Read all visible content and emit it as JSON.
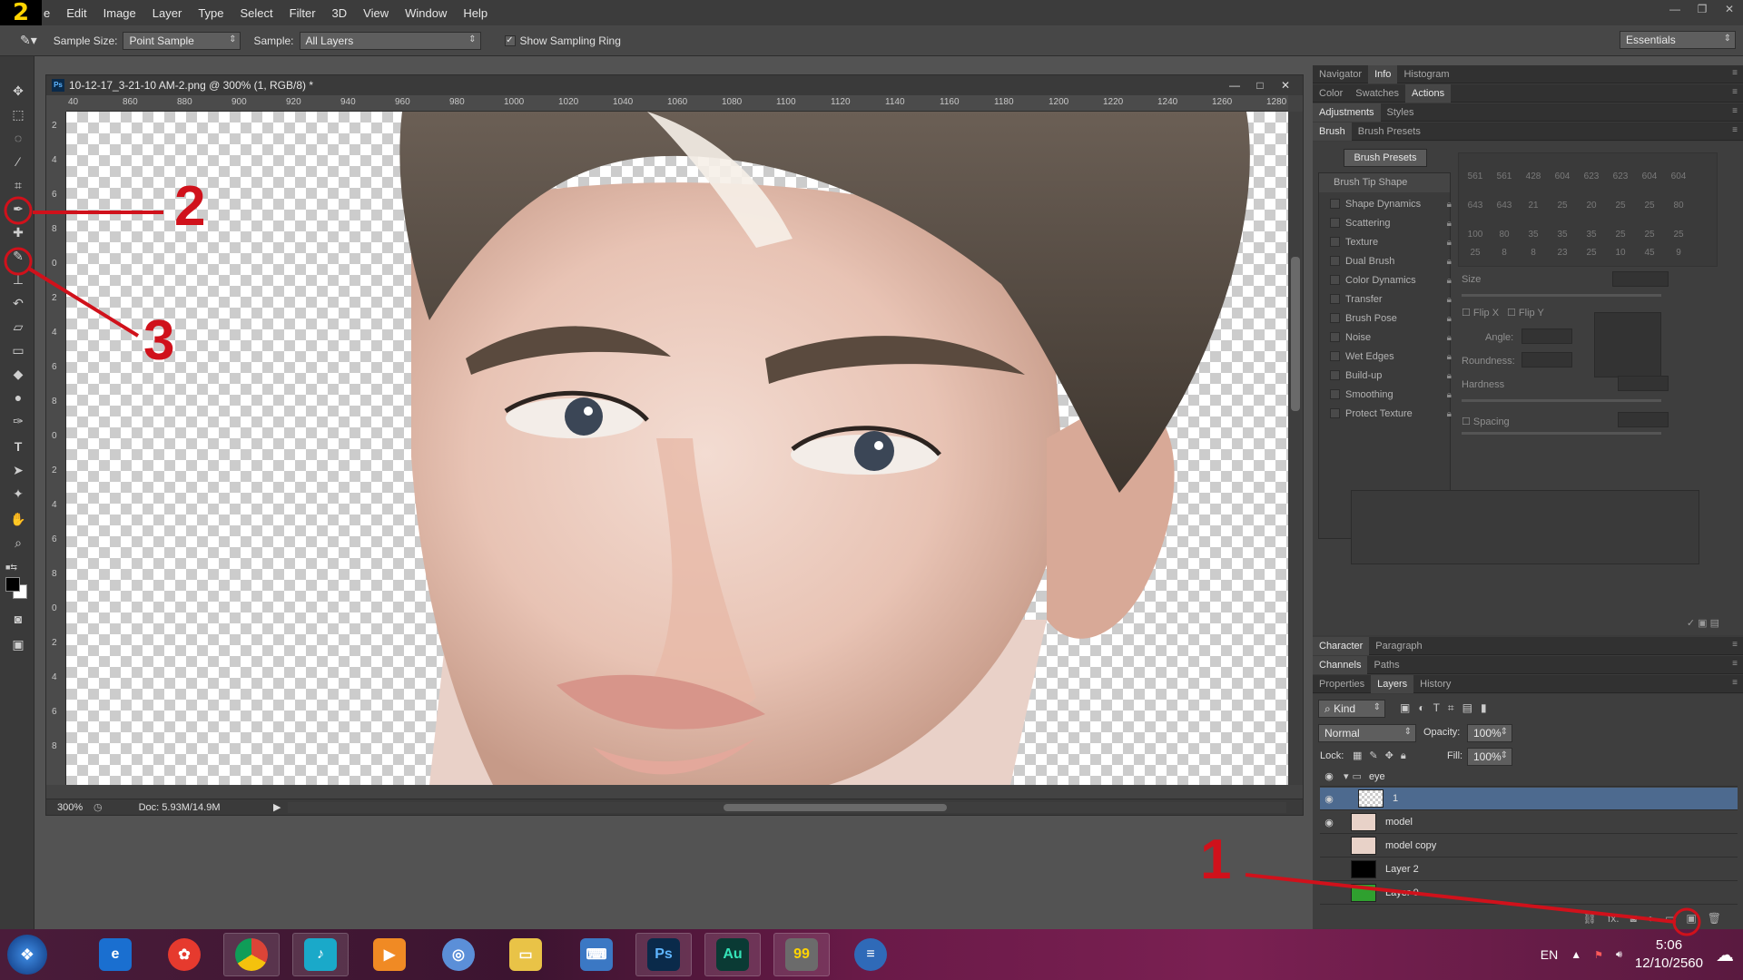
{
  "app": {
    "logo_text": "2",
    "menu": [
      "e",
      "Edit",
      "Image",
      "Layer",
      "Type",
      "Select",
      "Filter",
      "3D",
      "View",
      "Window",
      "Help"
    ],
    "window_controls": [
      "—",
      "❐",
      "✕"
    ]
  },
  "options_bar": {
    "sample_size_label": "Sample Size:",
    "sample_size_value": "Point Sample",
    "sample_label": "Sample:",
    "sample_value": "All Layers",
    "show_ring_label": "Show Sampling Ring",
    "workspace": "Essentials"
  },
  "document": {
    "title": "10-12-17_3-21-10 AM-2.png @ 300% (1, RGB/8) *",
    "zoom": "300%",
    "doc_size": "Doc: 5.93M/14.9M",
    "ruler_h": [
      "40",
      "860",
      "880",
      "900",
      "920",
      "940",
      "960",
      "980",
      "1000",
      "1020",
      "1040",
      "1060",
      "1080",
      "1100",
      "1120",
      "1140",
      "1160",
      "1180",
      "1200",
      "1220",
      "1240",
      "1260",
      "1280"
    ],
    "ruler_v": [
      "2",
      "4",
      "6",
      "8",
      "0",
      "2",
      "4",
      "6",
      "8",
      "0",
      "2",
      "4",
      "6",
      "8",
      "0",
      "2",
      "4",
      "6",
      "8"
    ]
  },
  "panels": {
    "row1": [
      "Navigator",
      "Info",
      "Histogram"
    ],
    "row2": [
      "Color",
      "Swatches",
      "Actions"
    ],
    "row3": [
      "Adjustments",
      "Styles"
    ],
    "row4": [
      "Brush",
      "Brush Presets"
    ],
    "brush_presets_button": "Brush Presets",
    "brush_tip_shape": "Brush Tip Shape",
    "brush_options": [
      "Shape Dynamics",
      "Scattering",
      "Texture",
      "Dual Brush",
      "Color Dynamics",
      "Transfer",
      "Brush Pose",
      "Noise",
      "Wet Edges",
      "Build-up",
      "Smoothing",
      "Protect Texture"
    ],
    "tip_row1": [
      "561",
      "561",
      "428",
      "604",
      "623",
      "623",
      "604",
      "604"
    ],
    "tip_row2": [
      "643",
      "643",
      "21",
      "25",
      "20",
      "25",
      "25",
      "80"
    ],
    "tip_row3": [
      "100",
      "80",
      "35",
      "35",
      "35",
      "25",
      "25",
      "25"
    ],
    "tip_row4": [
      "25",
      "8",
      "8",
      "23",
      "25",
      "10",
      "45",
      "9"
    ],
    "size_label": "Size",
    "flip_x": "Flip X",
    "flip_y": "Flip Y",
    "angle_label": "Angle:",
    "roundness_label": "Roundness:",
    "hardness_label": "Hardness",
    "spacing_label": "Spacing",
    "row5": [
      "Character",
      "Paragraph"
    ],
    "row6": [
      "Channels",
      "Paths"
    ],
    "row7": [
      "Properties",
      "Layers",
      "History"
    ]
  },
  "layers": {
    "filter_kind": "Kind",
    "blend_mode": "Normal",
    "opacity_label": "Opacity:",
    "opacity_value": "100%",
    "lock_label": "Lock:",
    "fill_label": "Fill:",
    "fill_value": "100%",
    "items": [
      {
        "name": "eye",
        "type": "group"
      },
      {
        "name": "1",
        "type": "layer"
      },
      {
        "name": "model",
        "type": "layer"
      },
      {
        "name": "model copy",
        "type": "layer"
      },
      {
        "name": "Layer 2",
        "type": "layer"
      },
      {
        "name": "Layer 0",
        "type": "layer"
      }
    ],
    "footer_icons": [
      "link-icon",
      "fx-icon",
      "mask-icon",
      "adjustment-icon",
      "folder-icon",
      "new-layer-icon",
      "trash-icon"
    ]
  },
  "annotations": [
    "1",
    "2",
    "3"
  ],
  "taskbar": {
    "language": "EN",
    "time": "5:06",
    "date": "12/10/2560",
    "ps_label": "Ps",
    "au_label": "Au"
  },
  "colors": {
    "annotation_red": "#d0111b",
    "selected_layer": "#4d6a8f"
  }
}
